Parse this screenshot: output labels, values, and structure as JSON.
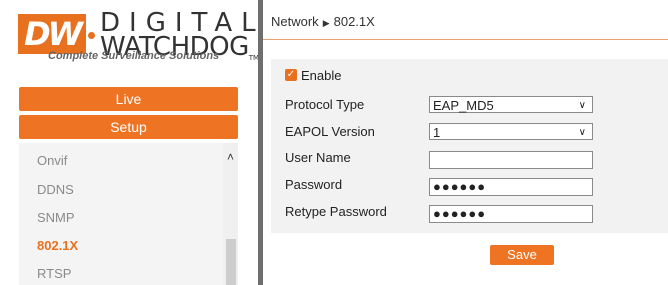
{
  "logo": {
    "mark": "DW",
    "line1": "DIGITAL",
    "line2": "WATCHDOG",
    "tm": "TM",
    "tagline": "Complete Surveillance Solutions"
  },
  "nav": {
    "live_label": "Live",
    "setup_label": "Setup"
  },
  "menu": {
    "items": [
      {
        "label": "Onvif"
      },
      {
        "label": "DDNS"
      },
      {
        "label": "SNMP"
      },
      {
        "label": "802.1X"
      },
      {
        "label": "RTSP"
      }
    ],
    "active": "802.1X"
  },
  "breadcrumb": {
    "parent": "Network",
    "separator": "▶",
    "current": "802.1X"
  },
  "form": {
    "enable_label": "Enable",
    "enable_checked": true,
    "protocol_type_label": "Protocol Type",
    "protocol_type_value": "EAP_MD5",
    "eapol_version_label": "EAPOL Version",
    "eapol_version_value": "1",
    "user_name_label": "User Name",
    "user_name_value": "",
    "password_label": "Password",
    "password_value": "●●●●●●",
    "retype_password_label": "Retype Password",
    "retype_password_value": "●●●●●●"
  },
  "actions": {
    "save_label": "Save"
  },
  "colors": {
    "accent": "#ee7424",
    "divider": "#6e6e6e",
    "panel": "#f2f2f2"
  }
}
